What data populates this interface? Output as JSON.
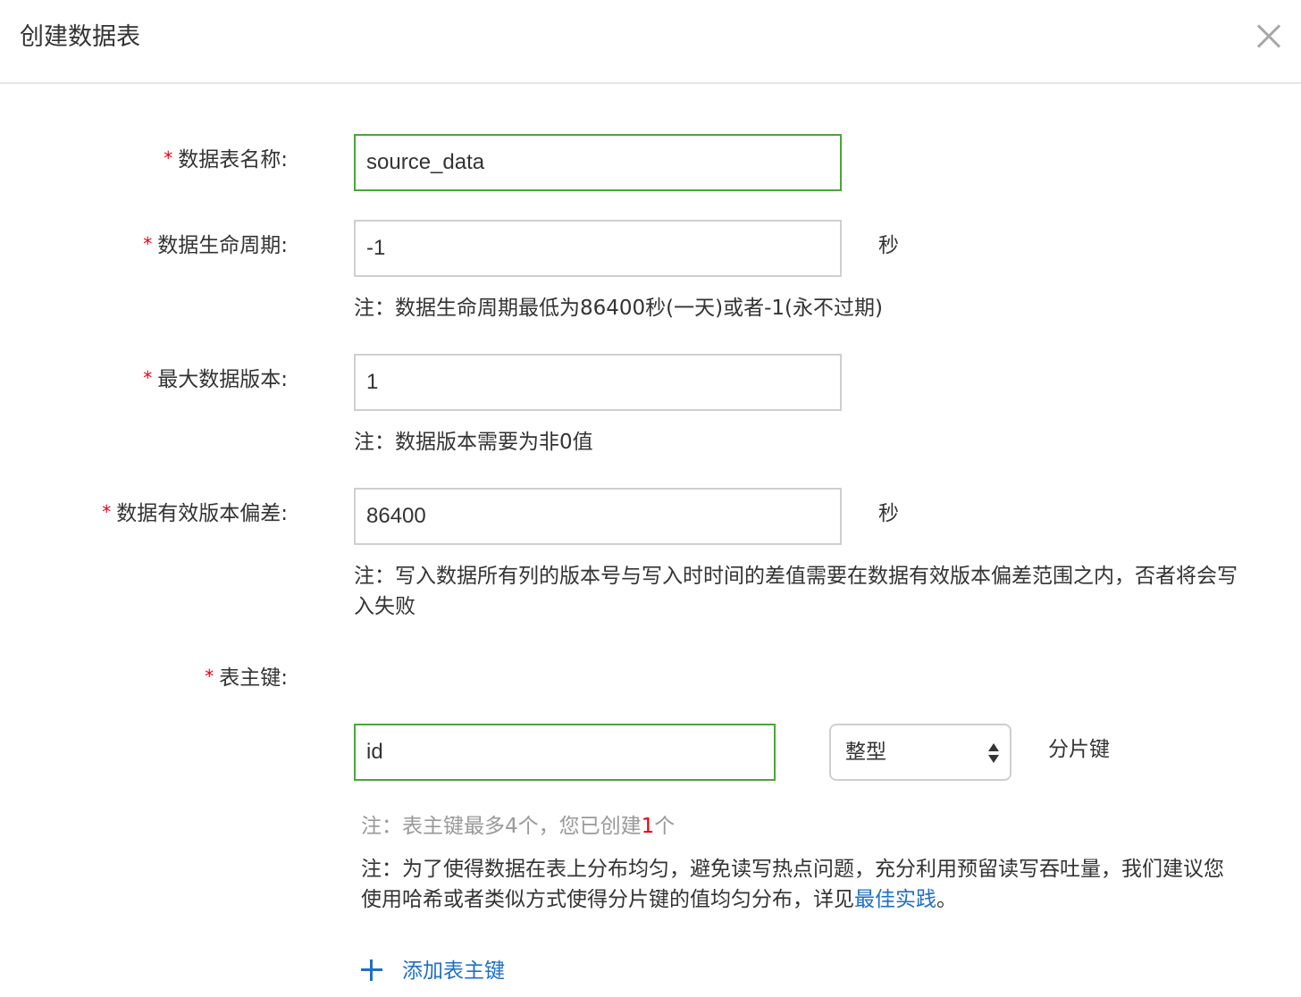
{
  "dialog": {
    "title": "创建数据表"
  },
  "colors": {
    "required_mark": "#e60012",
    "valid_border": "#4ca53b",
    "link": "#1f6fc5"
  },
  "form": {
    "required_mark": "*",
    "table_name": {
      "label": "数据表名称:",
      "value": "source_data"
    },
    "ttl": {
      "label": "数据生命周期:",
      "value": "-1",
      "unit": "秒",
      "note": "注：数据生命周期最低为86400秒(一天)或者-1(永不过期)"
    },
    "max_versions": {
      "label": "最大数据版本:",
      "value": "1",
      "note": "注：数据版本需要为非0值"
    },
    "max_time_deviation": {
      "label": "数据有效版本偏差:",
      "value": "86400",
      "unit": "秒",
      "note_line1": "注：写入数据所有列的版本号与写入时时间的差值需要在数据有效版本偏差范围之内，否者将会写",
      "note_line2": "入失败"
    },
    "primary_key": {
      "label": "表主键:",
      "rows": [
        {
          "name": "id",
          "type": "整型",
          "role": "分片键"
        }
      ],
      "limit_note_prefix": "注：表主键最多4个，您已创建",
      "limit_count": "1",
      "limit_note_suffix": "个",
      "partition_note_line1": "注：为了使得数据在表上分布均匀，避免读写热点问题，充分利用预留读写吞吐量，我们建议您",
      "partition_note_line2": "使用哈希或者类似方式使得分片键的值均匀分布，详见",
      "best_practice_link": "最佳实践",
      "partition_note_end": "。",
      "add_button": "添加表主键"
    }
  }
}
